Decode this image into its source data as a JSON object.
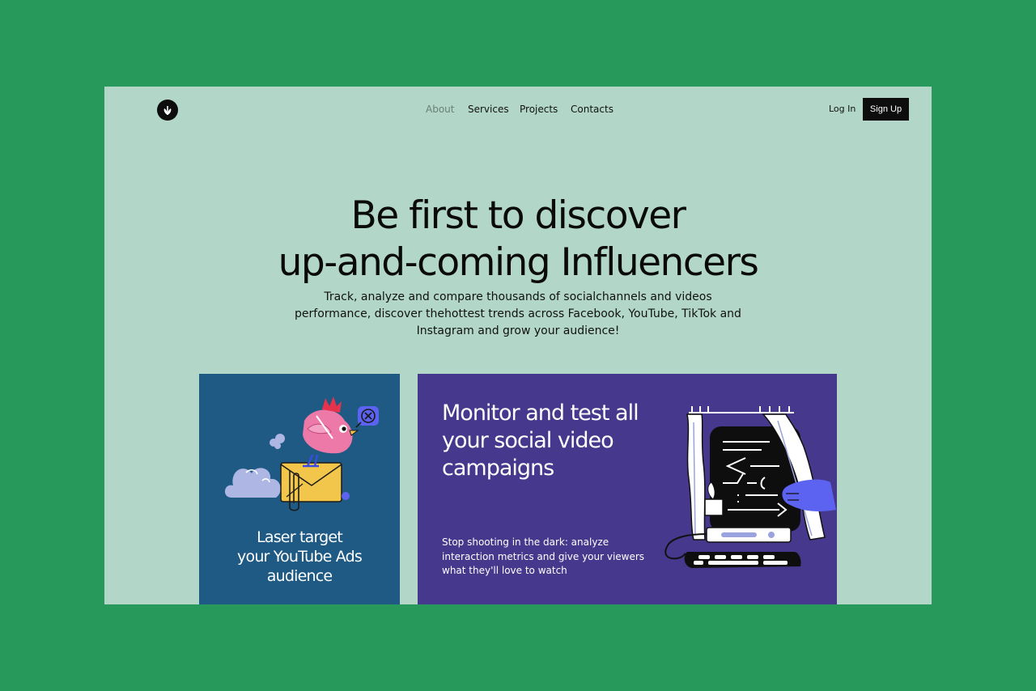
{
  "nav": {
    "items": [
      {
        "label": "About",
        "active": true
      },
      {
        "label": "Services",
        "active": false
      },
      {
        "label": "Projects",
        "active": false
      },
      {
        "label": "Contacts",
        "active": false
      }
    ],
    "login_label": "Log In",
    "signup_label": "Sign Up",
    "logo_icon": "sprout-icon"
  },
  "hero": {
    "title_line1": "Be first to discover",
    "title_line2": "up-and-coming Influencers",
    "subtitle_line1": "Track, analyze and compare thousands of socialchannels and videos",
    "subtitle_line2": "performance, discover thehottest trends across Facebook, YouTube, TikTok and",
    "subtitle_line3": "Instagram and grow your audience!"
  },
  "cards": {
    "left": {
      "caption_line1": "Laser target",
      "caption_line2": "your YouTube Ads",
      "caption_line3": "audience",
      "color": "#1f5a85"
    },
    "right": {
      "heading_line1": "Monitor and test all",
      "heading_line2": "your social video",
      "heading_line3": "campaigns",
      "body_line1": "Stop shooting in the dark: analyze",
      "body_line2": "interaction metrics and give your viewers",
      "body_line3": "what they'll love to watch",
      "color": "#46388c"
    }
  },
  "colors": {
    "outer_background": "#279a5b",
    "page_background": "#b2d7c8",
    "accent_dark": "#0d0d0d"
  }
}
